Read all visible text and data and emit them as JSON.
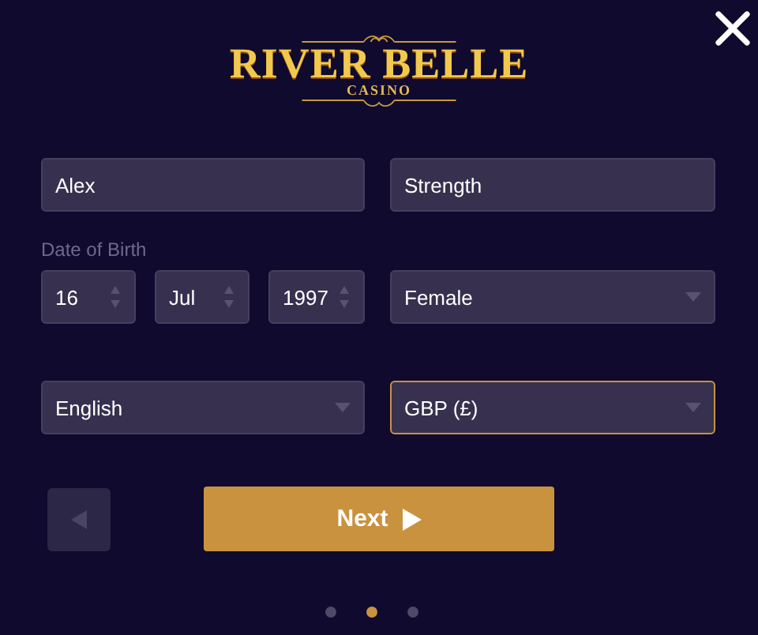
{
  "logo": {
    "title": "RIVER BELLE",
    "subtitle": "CASINO"
  },
  "first_name": {
    "value": "Alex"
  },
  "last_name": {
    "value": "Strength"
  },
  "date_of_birth": {
    "label": "Date of Birth",
    "parts": [
      {
        "value": "16"
      },
      {
        "value": "Jul"
      },
      {
        "value": "1997"
      }
    ]
  },
  "gender": {
    "value": "Female",
    "focused": false
  },
  "language": {
    "value": "English",
    "focused": false
  },
  "currency": {
    "value": "GBP (£)",
    "focused": true
  },
  "back_button": {
    "disabled": true
  },
  "next_button": {
    "label": "Next"
  },
  "steps": [
    {
      "selected": false
    },
    {
      "selected": true
    },
    {
      "selected": false
    }
  ]
}
